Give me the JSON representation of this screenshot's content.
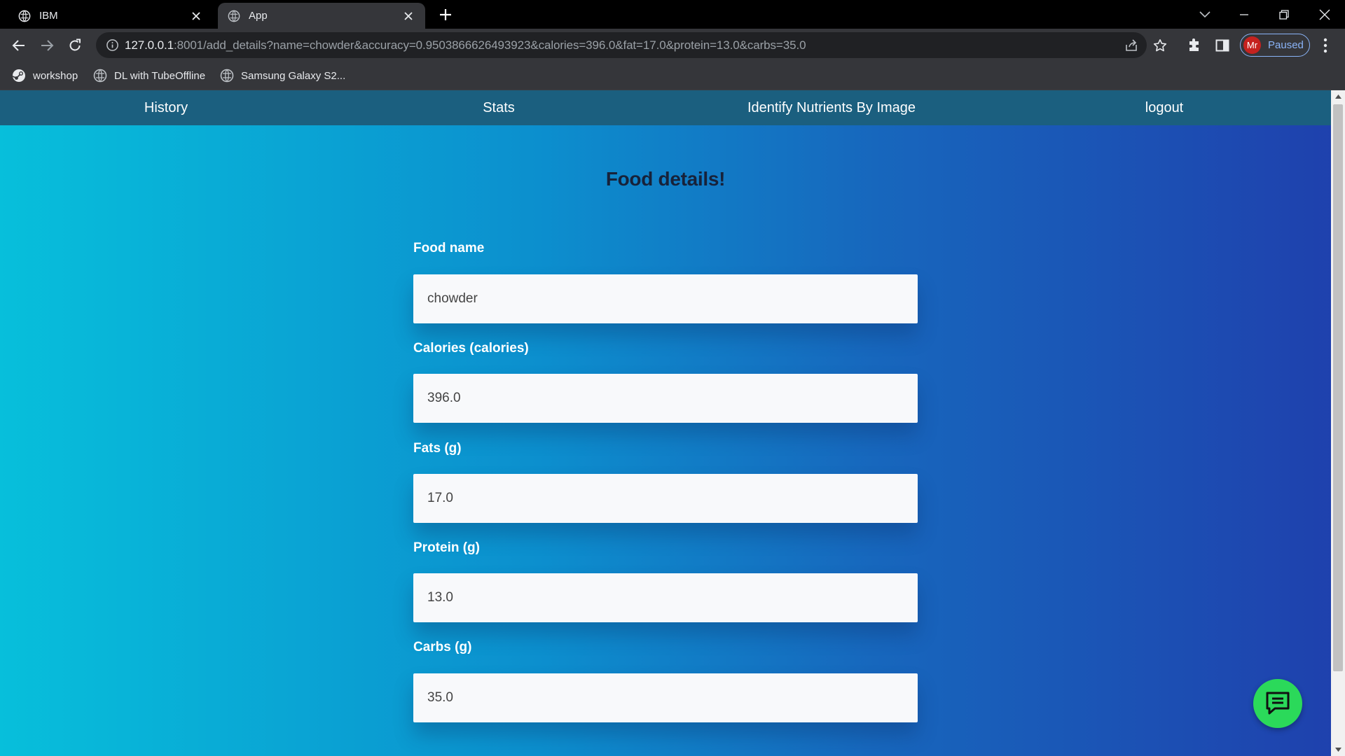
{
  "browser": {
    "tabs": [
      {
        "title": "IBM",
        "icon": "globe-icon"
      },
      {
        "title": "App",
        "icon": "globe-icon"
      }
    ],
    "url_host": "127.0.0.1",
    "url_rest": ":8001/add_details?name=chowder&accuracy=0.9503866626493923&calories=396.0&fat=17.0&protein=13.0&carbs=35.0",
    "profile_initials": "Mr",
    "profile_label": "Paused",
    "bookmarks": [
      {
        "label": "workshop",
        "icon": "steam-icon"
      },
      {
        "label": "DL with TubeOffline",
        "icon": "globe-icon"
      },
      {
        "label": "Samsung Galaxy S2...",
        "icon": "globe-icon"
      }
    ]
  },
  "nav": {
    "items": [
      "History",
      "Stats",
      "Identify Nutrients By Image",
      "logout"
    ]
  },
  "form": {
    "title": "Food details!",
    "fields": [
      {
        "label": "Food name",
        "value": "chowder"
      },
      {
        "label": "Calories (calories)",
        "value": "396.0"
      },
      {
        "label": "Fats (g)",
        "value": "17.0"
      },
      {
        "label": "Protein (g)",
        "value": "13.0"
      },
      {
        "label": "Carbs (g)",
        "value": "35.0"
      }
    ]
  },
  "colors": {
    "accent_chat": "#2bd95a",
    "navbar": "#1b5f7f",
    "gradient_start": "#07bfdb",
    "gradient_end": "#1f40ad"
  }
}
